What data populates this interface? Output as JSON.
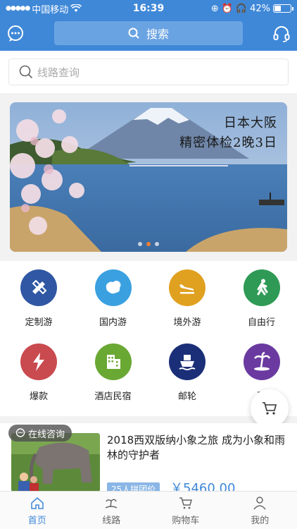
{
  "status_bar": {
    "carrier": "中国移动",
    "time": "16:39",
    "battery": "42%",
    "battery_level": 0.42
  },
  "header": {
    "search_label": "搜索",
    "message_icon": "chat-bubble-icon",
    "service_icon": "headset-icon"
  },
  "route_search": {
    "placeholder": "线路查询"
  },
  "banner": {
    "line1": "日本大阪",
    "line2": "精密体检2晚3日",
    "slide_count": 3,
    "active_slide": 1
  },
  "categories": [
    {
      "label": "定制游",
      "icon": "pencil-ruler-icon",
      "color": "#2f57a3"
    },
    {
      "label": "国内游",
      "icon": "china-map-icon",
      "color": "#3aa0e0"
    },
    {
      "label": "境外游",
      "icon": "plane-landing-icon",
      "color": "#e0a020"
    },
    {
      "label": "自由行",
      "icon": "walking-person-icon",
      "color": "#2e9a55"
    },
    {
      "label": "爆款",
      "icon": "lightning-icon",
      "color": "#c94a4f"
    },
    {
      "label": "酒店民宿",
      "icon": "building-icon",
      "color": "#6aa834"
    },
    {
      "label": "邮轮",
      "icon": "ship-icon",
      "color": "#1b2f78"
    },
    {
      "label": "更",
      "icon": "palm-island-icon",
      "color": "#6a3aa0"
    }
  ],
  "consult": {
    "label": "在线咨询"
  },
  "product": {
    "title": "2018西双版纳小象之旅 成为小象和雨林的守护者",
    "tag": "25人拼团价",
    "price": "￥5460.00"
  },
  "tabbar": [
    {
      "label": "首页",
      "icon": "home-icon",
      "active": true
    },
    {
      "label": "线路",
      "icon": "route-island-icon",
      "active": false
    },
    {
      "label": "购物车",
      "icon": "cart-icon",
      "active": false
    },
    {
      "label": "我的",
      "icon": "user-icon",
      "active": false
    }
  ]
}
